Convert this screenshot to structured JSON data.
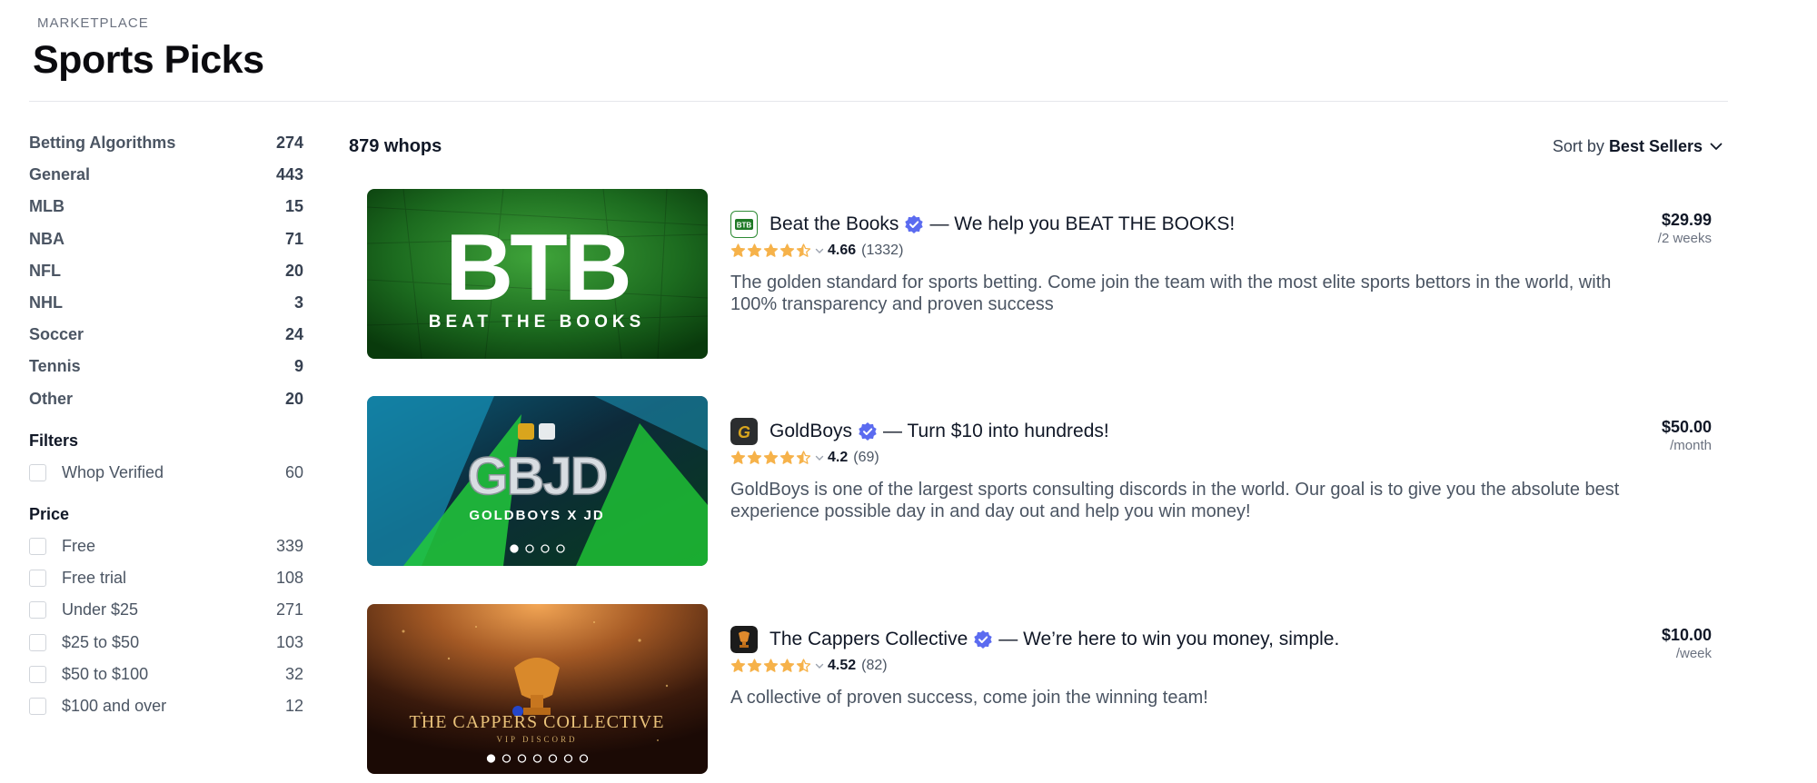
{
  "header": {
    "eyebrow": "MARKETPLACE",
    "title": "Sports Picks"
  },
  "sidebar": {
    "categories": [
      {
        "label": "Betting Algorithms",
        "count": "274"
      },
      {
        "label": "General",
        "count": "443"
      },
      {
        "label": "MLB",
        "count": "15"
      },
      {
        "label": "NBA",
        "count": "71"
      },
      {
        "label": "NFL",
        "count": "20"
      },
      {
        "label": "NHL",
        "count": "3"
      },
      {
        "label": "Soccer",
        "count": "24"
      },
      {
        "label": "Tennis",
        "count": "9"
      },
      {
        "label": "Other",
        "count": "20"
      }
    ],
    "filters_heading": "Filters",
    "filters": [
      {
        "label": "Whop Verified",
        "count": "60"
      }
    ],
    "price_heading": "Price",
    "prices": [
      {
        "label": "Free",
        "count": "339"
      },
      {
        "label": "Free trial",
        "count": "108"
      },
      {
        "label": "Under $25",
        "count": "271"
      },
      {
        "label": "$25 to $50",
        "count": "103"
      },
      {
        "label": "$50 to $100",
        "count": "32"
      },
      {
        "label": "$100 and over",
        "count": "12"
      }
    ]
  },
  "main": {
    "result_count": "879 whops",
    "sort_label": "Sort by",
    "sort_value": "Best Sellers",
    "listings": [
      {
        "name": "Beat the Books",
        "tagline": "— We help you BEAT THE BOOKS!",
        "rating": 4.66,
        "rating_text": "4.66",
        "reviews": "(1332)",
        "description": "The golden standard for sports betting. Come join the team with the most elite sports bettors in the world, with 100% transparency and proven success",
        "price": "$29.99",
        "period": "/2 weeks",
        "banner_title": "BTB",
        "banner_subtitle": "BEAT THE BOOKS",
        "logo_text": "BTB"
      },
      {
        "name": "GoldBoys",
        "tagline": "— Turn $10 into hundreds!",
        "rating": 4.2,
        "rating_text": "4.2",
        "reviews": "(69)",
        "description": "GoldBoys is one of the largest sports consulting discords in the world. Our goal is to give you the absolute best experience possible day in and day out and help you win money!",
        "price": "$50.00",
        "period": "/month",
        "banner_title": "GBJD",
        "banner_subtitle": "GOLDBOYS X JD",
        "logo_text": "G",
        "carousel_slides": 4
      },
      {
        "name": "The Cappers Collective",
        "tagline": "— We’re here to win you money, simple.",
        "rating": 4.52,
        "rating_text": "4.52",
        "reviews": "(82)",
        "description": "A collective of proven success, come join the winning team!",
        "price": "$10.00",
        "period": "/week",
        "banner_title": "THE CAPPERS COLLECTIVE",
        "banner_subtitle": "VIP DISCORD",
        "carousel_slides": 7
      }
    ]
  },
  "colors": {
    "verified": "#5b6bf0",
    "star": "#f6b24a",
    "star_empty": "#f6b24a",
    "btb_green": "#1f8f2c"
  }
}
